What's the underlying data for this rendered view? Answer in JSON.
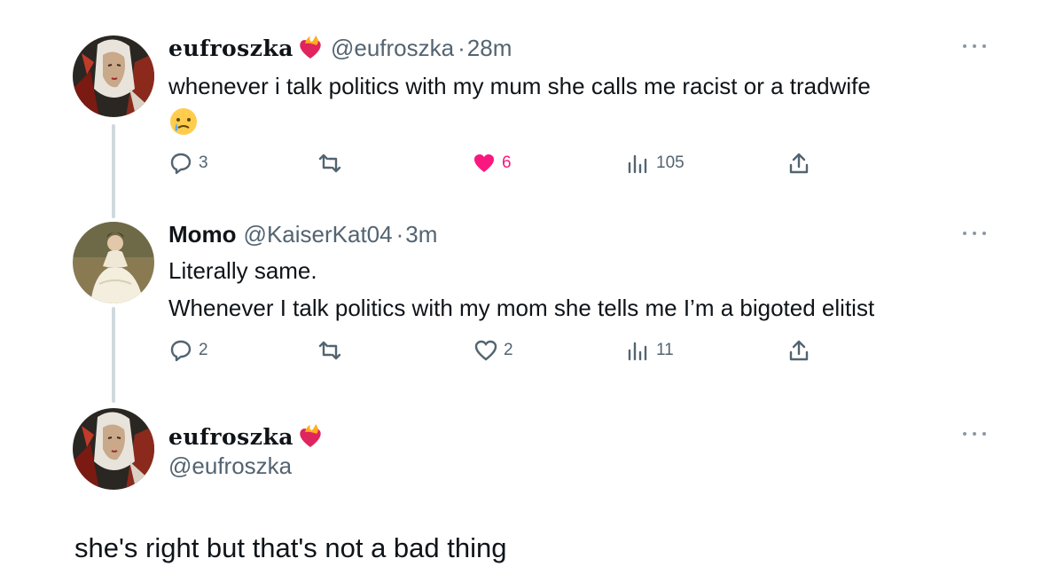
{
  "tweets": [
    {
      "display_name": "eufroszka",
      "handle": "@eufroszka",
      "time": "28m",
      "text": "whenever i talk politics with my mum she calls me racist or a tradwife",
      "replies": "3",
      "likes": "6",
      "views": "105",
      "liked": true
    },
    {
      "display_name": "Momo",
      "handle": "@KaiserKat04",
      "time": "3m",
      "text_line1": "Literally same.",
      "text_line2": "Whenever I talk politics with my mom she tells me I’m a bigoted elitist",
      "replies": "2",
      "likes": "2",
      "views": "11",
      "liked": false
    }
  ],
  "main_post": {
    "display_name": "eufroszka",
    "handle": "@eufroszka",
    "text": "she's right but that's not a bad thing"
  },
  "colors": {
    "text": "#0f1419",
    "secondary": "#536471",
    "like": "#f91880",
    "thread_line": "#cfd9de"
  }
}
